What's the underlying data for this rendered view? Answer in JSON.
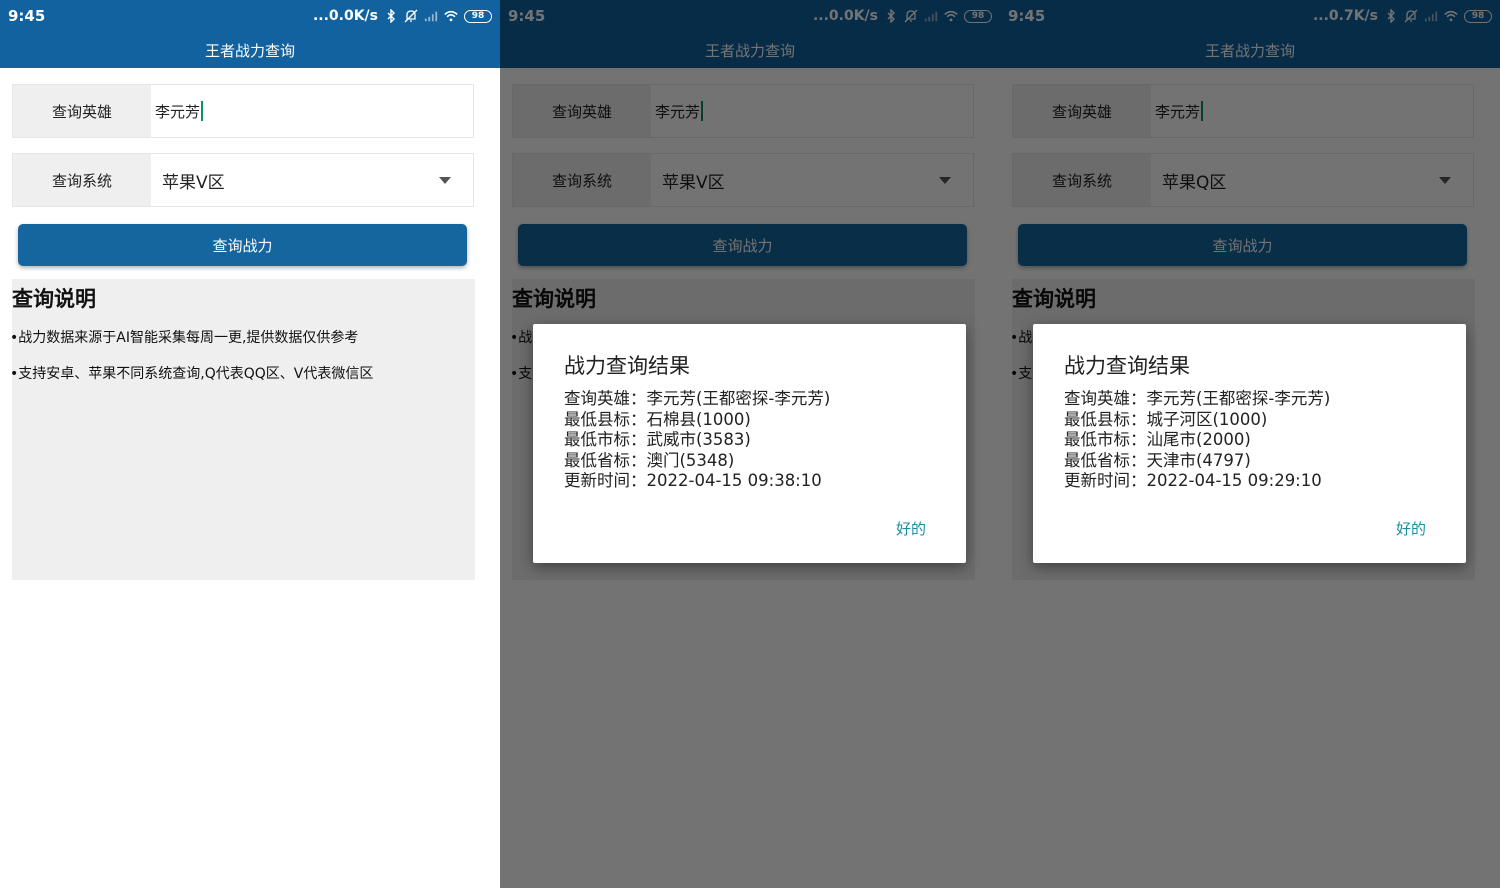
{
  "screens": [
    {
      "status": {
        "time": "9:45",
        "speed": "...0.0K/s",
        "battery": "98"
      },
      "app_title": "王者战力查询",
      "hero_label": "查询英雄",
      "hero_value": "李元芳",
      "system_label": "查询系统",
      "system_value": "苹果V区",
      "query_button": "查询战力",
      "info_title": "查询说明",
      "info_lines": [
        "•战力数据来源于AI智能采集每周一更,提供数据仅供参考",
        "•支持安卓、苹果不同系统查询,Q代表QQ区、V代表微信区"
      ]
    },
    {
      "status": {
        "time": "9:45",
        "speed": "...0.0K/s",
        "battery": "98"
      },
      "app_title": "王者战力查询",
      "hero_label": "查询英雄",
      "hero_value": "李元芳",
      "system_label": "查询系统",
      "system_value": "苹果V区",
      "query_button": "查询战力",
      "info_title": "查询说明",
      "info_lines": [
        "•战",
        "•支"
      ],
      "dialog": {
        "title": "战力查询结果",
        "lines": [
          "查询英雄：李元芳(王都密探-李元芳)",
          "最低县标：石棉县(1000)",
          "最低市标：武威市(3583)",
          "最低省标：澳门(5348)",
          "更新时间：2022-04-15 09:38:10"
        ],
        "ok": "好的"
      }
    },
    {
      "status": {
        "time": "9:45",
        "speed": "...0.7K/s",
        "battery": "98"
      },
      "app_title": "王者战力查询",
      "hero_label": "查询英雄",
      "hero_value": "李元芳",
      "system_label": "查询系统",
      "system_value": "苹果Q区",
      "query_button": "查询战力",
      "info_title": "查询说明",
      "info_lines": [
        "•战",
        "•支"
      ],
      "dialog": {
        "title": "战力查询结果",
        "lines": [
          "查询英雄：李元芳(王都密探-李元芳)",
          "最低县标：城子河区(1000)",
          "最低市标：汕尾市(2000)",
          "最低省标：天津市(4797)",
          "更新时间：2022-04-15 09:29:10"
        ],
        "ok": "好的"
      }
    }
  ],
  "colors": {
    "primary": "#11629f",
    "button": "#15669f",
    "dialog_ok": "#1a8fa0",
    "panel": "#efefef"
  }
}
